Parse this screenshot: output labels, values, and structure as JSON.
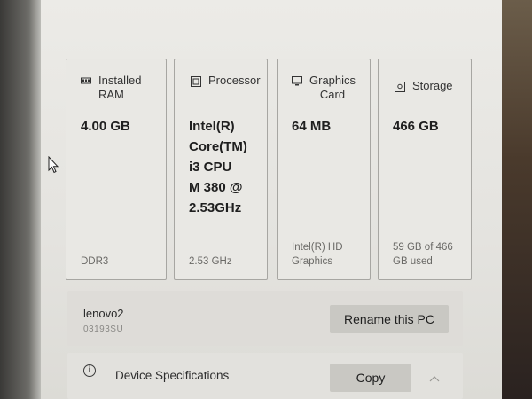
{
  "specs_cards": [
    {
      "title": "Installed\nRAM",
      "value": "4.00 GB",
      "footnote": "DDR3",
      "icon": "memory-icon"
    },
    {
      "title": "Processor",
      "value": "Intel(R)\nCore(TM)\ni3 CPU\nM 380  @\n2.53GHz",
      "footnote": "2.53 GHz",
      "icon": "processor-icon"
    },
    {
      "title": "Graphics\nCard",
      "value": "64 MB",
      "footnote": "Intel(R) HD\nGraphics",
      "icon": "monitor-icon"
    },
    {
      "title": "Storage",
      "value": "466 GB",
      "footnote": "59 GB of 466\nGB used",
      "icon": "disk-icon"
    }
  ],
  "pc": {
    "name": "lenovo2",
    "subtitle": "03193SU",
    "rename_label": "Rename this PC"
  },
  "device_specs": {
    "label": "Device Specifications",
    "copy_label": "Copy",
    "info_icon_glyph": "i",
    "icons": [
      "info-icon",
      "chevron-up-icon"
    ]
  }
}
